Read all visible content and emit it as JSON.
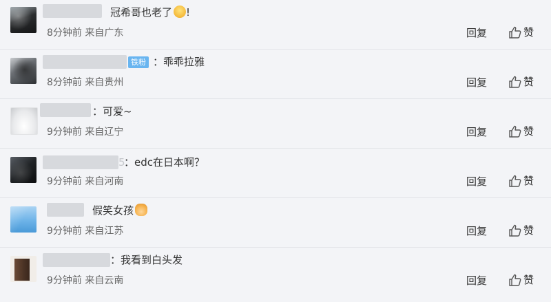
{
  "actions": {
    "reply_label": "回复",
    "like_label": "赞"
  },
  "comments": [
    {
      "text": "冠希哥也老了",
      "emoji": "crying-face-emoji",
      "suffix": "!",
      "meta": "8分钟前 来自广东"
    },
    {
      "badge": "铁粉",
      "text": "：乖乖拉雅",
      "meta": "8分钟前 来自贵州"
    },
    {
      "text": "：可爱~",
      "meta": "9分钟前 来自辽宁"
    },
    {
      "name_tail": "5",
      "text": "：edc在日本啊？",
      "meta": "9分钟前 来自河南"
    },
    {
      "text": "假笑女孩",
      "emoji": "person-emoji",
      "meta": "9分钟前 来自江苏"
    },
    {
      "text": "：我看到白头发",
      "meta": "9分钟前 来自云南"
    }
  ],
  "colors": {
    "background": "#f3f4f7",
    "badge": "#69b5f0",
    "text": "#333333",
    "meta": "#666666"
  }
}
